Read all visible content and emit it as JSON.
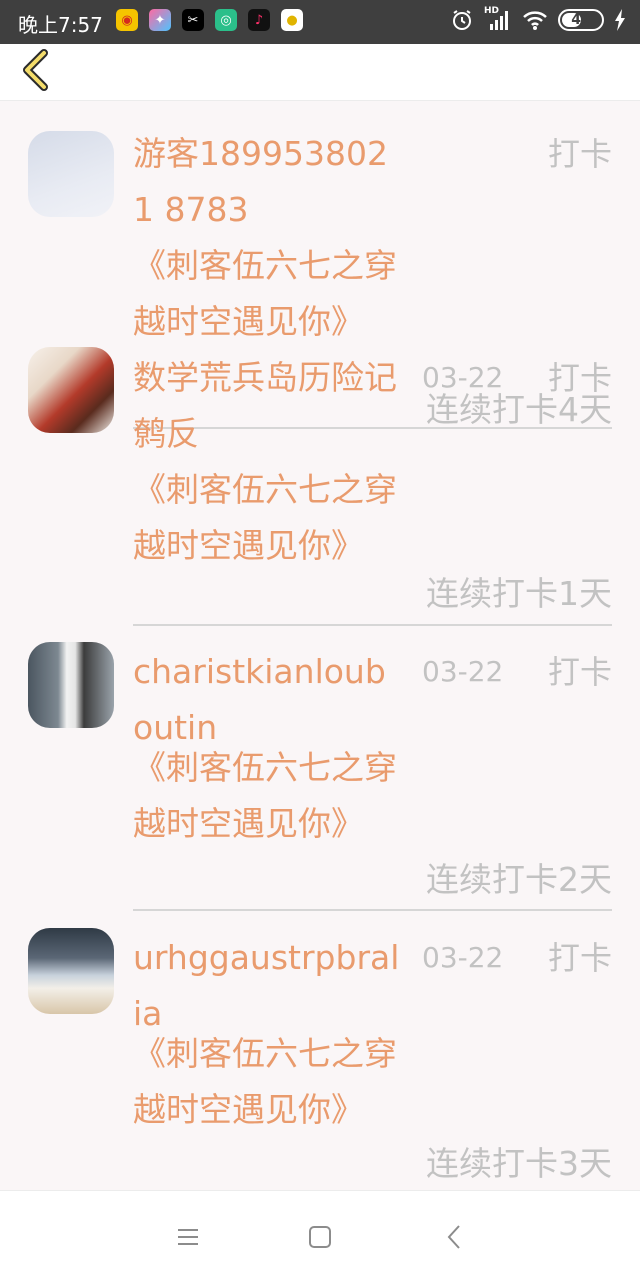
{
  "status_bar": {
    "time": "晚上7:57",
    "network": "HD",
    "battery": "49",
    "battery_level": 0.49
  },
  "header": {
    "back_icon": "chevron-left-icon"
  },
  "entries": [
    {
      "name": "游客1899538021 8783",
      "book": "《刺客伍六七之穿越时空遇见你》",
      "date": "",
      "action": "打卡",
      "streak": "连续打卡4天"
    },
    {
      "name": "数学荒兵岛历险记鹩反",
      "book": "《刺客伍六七之穿越时空遇见你》",
      "date": "03-22",
      "action": "打卡",
      "streak": "连续打卡1天"
    },
    {
      "name": "charistkianlouboutin",
      "book": "《刺客伍六七之穿越时空遇见你》",
      "date": "03-22",
      "action": "打卡",
      "streak": "连续打卡2天"
    },
    {
      "name": "urhggaustrpbralia",
      "book": "《刺客伍六七之穿越时空遇见你》",
      "date": "03-22",
      "action": "打卡",
      "streak": "连续打卡3天"
    }
  ],
  "nav": {
    "menu_icon": "menu-icon",
    "home_icon": "home-square-icon",
    "back_icon": "back-triangle-icon"
  }
}
